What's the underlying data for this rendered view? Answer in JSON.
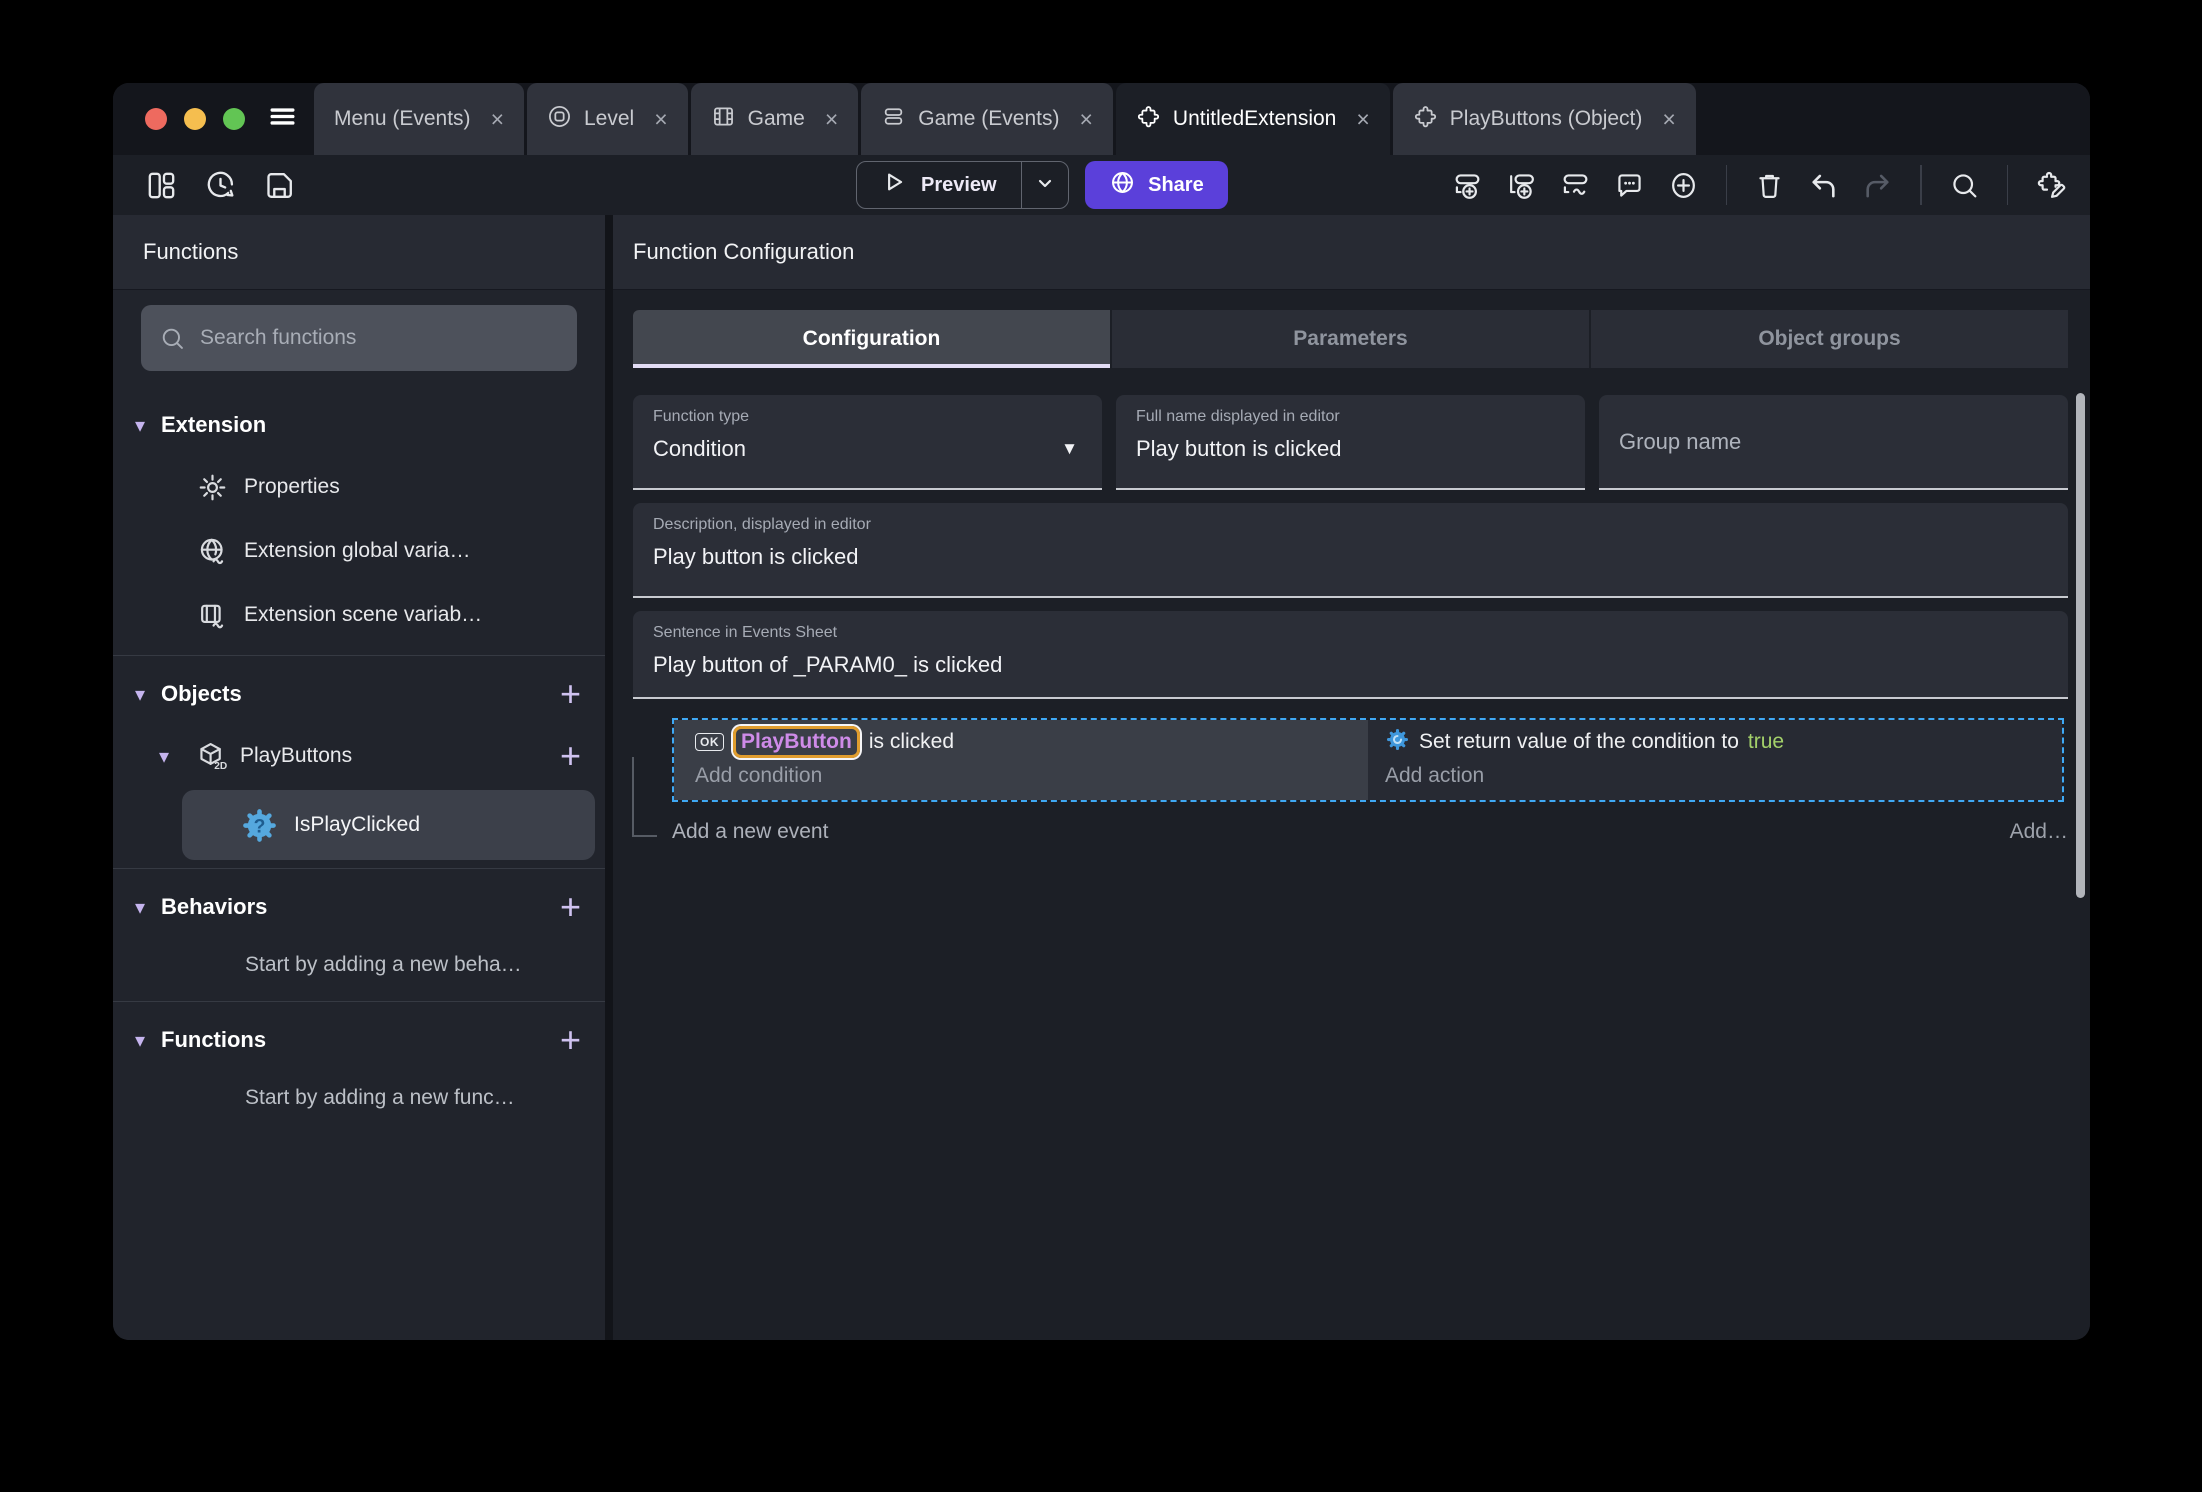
{
  "window": {
    "tab_close_glyph": "×",
    "tabs": [
      {
        "label": "Menu (Events)"
      },
      {
        "label": "Level"
      },
      {
        "label": "Game"
      },
      {
        "label": "Game (Events)"
      },
      {
        "label": "UntitledExtension"
      },
      {
        "label": "PlayButtons (Object)"
      }
    ]
  },
  "toolbar": {
    "preview": "Preview",
    "share": "Share"
  },
  "sidebar": {
    "title": "Functions",
    "add_glyph": "+",
    "chevron_glyph": "▾",
    "search": {
      "placeholder": "Search functions"
    },
    "sections": [
      {
        "label": "Extension",
        "items": [
          {
            "label": "Properties"
          },
          {
            "label": "Extension global varia…"
          },
          {
            "label": "Extension scene variab…"
          }
        ]
      },
      {
        "label": "Objects",
        "items": [
          {
            "label": "PlayButtons"
          }
        ],
        "sub_items": [
          {
            "label": "IsPlayClicked",
            "selected": true
          }
        ]
      },
      {
        "label": "Behaviors",
        "empty": "Start by adding a new beha…"
      },
      {
        "label": "Functions",
        "empty": "Start by adding a new func…"
      }
    ]
  },
  "main": {
    "title": "Function Configuration",
    "tabs": [
      {
        "label": "Configuration",
        "active": true
      },
      {
        "label": "Parameters"
      },
      {
        "label": "Object groups"
      }
    ],
    "fields": {
      "function_type": {
        "label": "Function type",
        "value": "Condition"
      },
      "full_name": {
        "label": "Full name displayed in editor",
        "value": "Play button is clicked"
      },
      "group_name": {
        "placeholder": "Group name"
      },
      "description": {
        "label": "Description, displayed in editor",
        "value": "Play button is clicked"
      },
      "sentence": {
        "label": "Sentence in Events Sheet",
        "value": "Play button of _PARAM0_ is clicked"
      }
    },
    "events": {
      "condition": {
        "object_badge": "OK",
        "object_name": "PlayButton",
        "suffix": "is clicked",
        "add_label": "Add condition"
      },
      "action": {
        "prefix": "Set return value of the condition to",
        "value": "true",
        "add_label": "Add action"
      },
      "add_new_event": "Add a new event",
      "add_more": "Add…"
    }
  },
  "colors": {
    "accent_purple": "#5B40DA",
    "selection_blue": "#3FA9F5",
    "object_name_purple": "#CE8BE8",
    "object_highlight_orange": "#E09D2E",
    "boolean_true_green": "#A3D06A"
  }
}
